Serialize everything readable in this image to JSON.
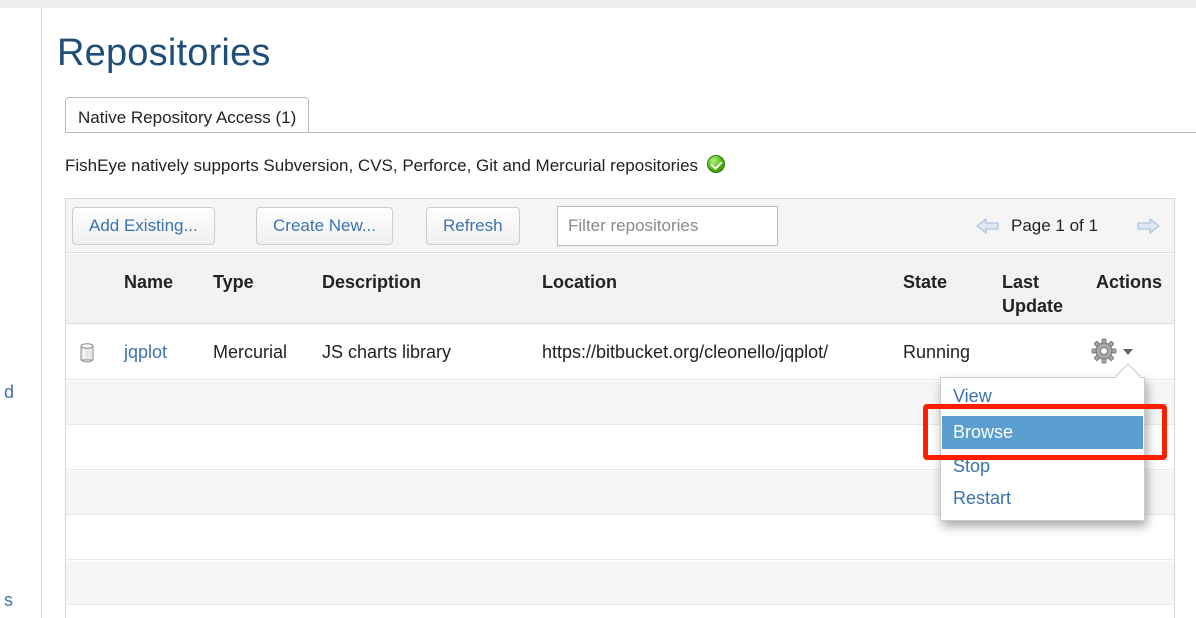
{
  "sidebar": {
    "frag_1": "d",
    "frag_2": "s"
  },
  "page": {
    "title": "Repositories"
  },
  "tabs": [
    {
      "label": "Native Repository Access (1)"
    }
  ],
  "info_text": "FishEye natively supports Subversion, CVS, Perforce, Git and Mercurial repositories",
  "toolbar": {
    "add_existing": "Add Existing...",
    "create_new": "Create New...",
    "refresh": "Refresh",
    "filter_placeholder": "Filter repositories",
    "page_info": "Page 1 of 1"
  },
  "table": {
    "headers": {
      "name": "Name",
      "type": "Type",
      "description": "Description",
      "location": "Location",
      "state": "State",
      "last_update_1": "Last",
      "last_update_2": "Update",
      "actions": "Actions"
    },
    "rows": [
      {
        "name": "jqplot",
        "type": "Mercurial",
        "description": "JS charts library",
        "location": "https://bitbucket.org/cleonello/jqplot/",
        "state": "Running",
        "last_update": ""
      }
    ]
  },
  "actions_menu": {
    "items": [
      {
        "label": "View"
      },
      {
        "label": "Browse"
      },
      {
        "label": "Stop"
      },
      {
        "label": "Restart"
      }
    ],
    "selected": "Browse"
  },
  "icons": {
    "status": "ok-check-icon",
    "repo": "database-icon",
    "actions": "gear-icon",
    "dropdown": "caret-down-icon",
    "prev": "arrow-left-icon",
    "next": "arrow-right-icon"
  },
  "colors": {
    "title": "#1f4e7a",
    "link": "#3b73af",
    "menu_selected": "#5b9fd1",
    "annotation": "#ff1f00"
  }
}
